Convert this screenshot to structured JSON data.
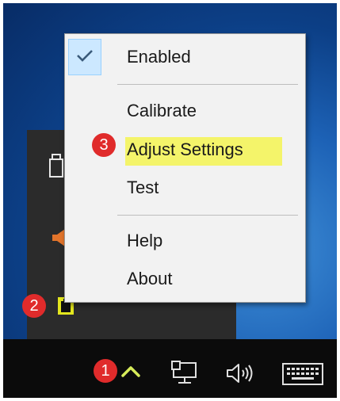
{
  "menu": {
    "items": [
      {
        "label": "Enabled",
        "checked": true
      },
      {
        "label": "Calibrate"
      },
      {
        "label": "Adjust Settings"
      },
      {
        "label": "Test"
      },
      {
        "label": "Help"
      },
      {
        "label": "About"
      }
    ]
  },
  "badges": [
    "1",
    "2",
    "3"
  ],
  "icons": {
    "check": "checkmark-icon",
    "flyout": [
      "usb-drive-icon",
      "speaker-orange-icon",
      "app-tray-icon"
    ],
    "taskbar": [
      "chevron-up-icon",
      "network-icon",
      "volume-icon",
      "keyboard-icon"
    ]
  },
  "colors": {
    "highlight": "#f4f46a",
    "badge": "#e02b2b",
    "check_bg": "#cce8ff",
    "chevron": "#d7ec5a",
    "app_icon": "#e3e61e"
  }
}
